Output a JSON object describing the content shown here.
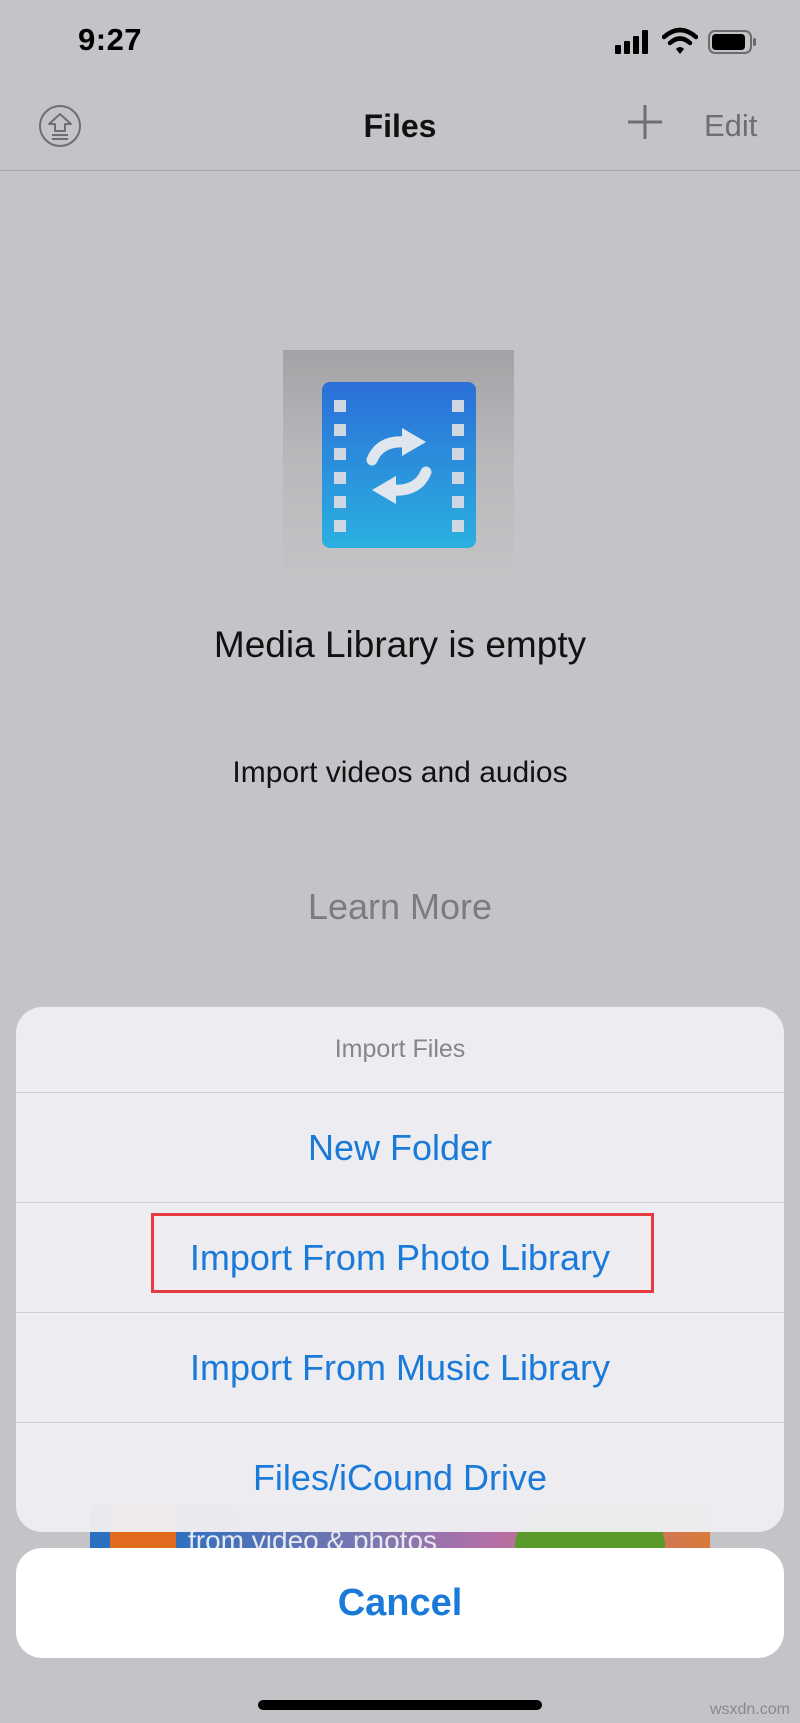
{
  "status_bar": {
    "time": "9:27"
  },
  "nav": {
    "title": "Files",
    "edit_label": "Edit"
  },
  "empty_state": {
    "title": "Media Library is empty",
    "subtitle": "Import videos and audios",
    "learn_more": "Learn More"
  },
  "ad": {
    "text": "from video & photos"
  },
  "action_sheet": {
    "title": "Import Files",
    "options": [
      {
        "label": "New Folder"
      },
      {
        "label": "Import From Photo Library"
      },
      {
        "label": "Import From Music Library"
      },
      {
        "label": "Files/iCound Drive"
      }
    ],
    "cancel_label": "Cancel"
  },
  "watermark": "wsxdn.com",
  "colors": {
    "accent": "#1a7ad9",
    "highlight": "#e53a40",
    "icon_blue_top": "#2b6fd8",
    "icon_blue_bottom": "#2bb0e0"
  },
  "icons": [
    "upload-icon",
    "plus-icon",
    "film-convert-icon",
    "signal-icon",
    "wifi-icon",
    "battery-icon"
  ]
}
